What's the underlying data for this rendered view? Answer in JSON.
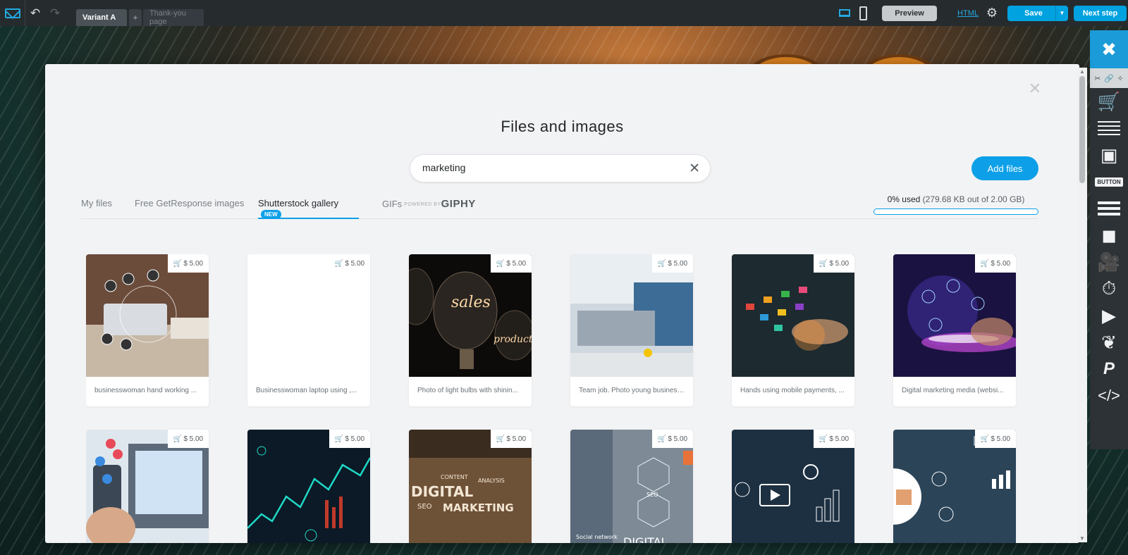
{
  "topbar": {
    "tabs": [
      {
        "label": "Variant A"
      },
      {
        "label": "+"
      },
      {
        "label": "Thank-you page"
      }
    ],
    "preview_label": "Preview",
    "html_label": "HTML",
    "save_label": "Save",
    "next_label": "Next step"
  },
  "rail": {
    "button_label": "BUTTON"
  },
  "modal": {
    "title": "Files and images",
    "search_value": "marketing",
    "add_files_label": "Add files",
    "tabs": [
      {
        "label": "My files"
      },
      {
        "label": "Free GetResponse images"
      },
      {
        "label": "Shutterstock gallery",
        "badge": "NEW"
      },
      {
        "label": "GIFs",
        "powered": "POWERED BY",
        "brand": "GIPHY"
      }
    ],
    "active_tab": "Shutterstock gallery",
    "usage": {
      "percent_text": "0% used",
      "detail_text": "(279.68 KB out of 2.00 GB)",
      "fraction": 0.0
    },
    "images": [
      {
        "price": "$ 5.00",
        "caption": "businesswoman hand working ..."
      },
      {
        "price": "$ 5.00",
        "caption": "Businesswoman laptop using ,..."
      },
      {
        "price": "$ 5.00",
        "caption": "Photo of light bulbs with shinin..."
      },
      {
        "price": "$ 5.00",
        "caption": "Team job. Photo young business..."
      },
      {
        "price": "$ 5.00",
        "caption": "Hands using mobile payments, ..."
      },
      {
        "price": "$ 5.00",
        "caption": "Digital marketing media (websi..."
      },
      {
        "price": "$ 5.00",
        "caption": ""
      },
      {
        "price": "$ 5.00",
        "caption": ""
      },
      {
        "price": "$ 5.00",
        "caption": ""
      },
      {
        "price": "$ 5.00",
        "caption": ""
      },
      {
        "price": "$ 5.00",
        "caption": ""
      },
      {
        "price": "$ 5.00",
        "caption": ""
      }
    ],
    "thumb_texts": {
      "sales": "sales",
      "product": "product",
      "digital": "DIGITAL",
      "marketing": "MARKETING",
      "content": "CONTENT",
      "analysis": "ANALYSIS",
      "seo": "SEO",
      "digital2": "DIGITAL",
      "social": "Social network",
      "seo2": "SEO"
    }
  },
  "colors": {
    "accent": "#0da0e8",
    "topbar_bg": "#262b2e",
    "rail_bg": "#2d3236",
    "modal_bg": "#f2f3f5"
  },
  "icons": {
    "logo": "getresponse-logo-icon",
    "undo": "undo-icon",
    "redo": "redo-icon",
    "desktop": "desktop-icon",
    "mobile": "mobile-icon",
    "settings": "gear-icon",
    "close": "close-icon",
    "clear": "clear-search-icon",
    "cart": "cart-icon"
  }
}
